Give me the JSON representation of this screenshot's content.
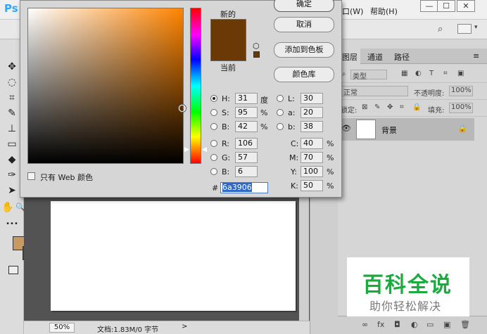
{
  "app": {
    "logo": "Ps",
    "menus": [
      "口(W)",
      "帮助(H)"
    ],
    "window_controls": [
      "—",
      "☐",
      "✕"
    ]
  },
  "tools": [
    "✥",
    "◌",
    "⌗",
    "✎",
    "⊥",
    "▭",
    "◆",
    "✑",
    "➤",
    "✋",
    "🔍",
    "•••"
  ],
  "status": {
    "zoom": "50%",
    "doc": "文档:1.83M/0 字节",
    "arrow": ">"
  },
  "layers_panel": {
    "tabs": [
      "图层",
      "通道",
      "路径"
    ],
    "filter_label": "类型",
    "blend_mode": "正常",
    "opacity_label": "不透明度:",
    "opacity_value": "100%",
    "lock_label": "锁定:",
    "fill_label": "填充:",
    "fill_value": "100%",
    "layer_name": "背景",
    "footer_icons": [
      "∞",
      "fx",
      "◘",
      "◐",
      "▭",
      "▣",
      "🗑"
    ]
  },
  "color_picker": {
    "new_label": "新的",
    "current_label": "当前",
    "new_color": "#6a3906",
    "current_color": "#6a3906",
    "buttons": {
      "ok": "确定",
      "cancel": "取消",
      "add_to_swatches": "添加到色板",
      "color_libraries": "颜色库"
    },
    "web_only_label": "只有 Web 颜色",
    "hsb": {
      "h_label": "H:",
      "h_value": "31",
      "h_unit": "度",
      "s_label": "S:",
      "s_value": "95",
      "s_unit": "%",
      "b_label": "B:",
      "b_value": "42",
      "b_unit": "%"
    },
    "rgb": {
      "r_label": "R:",
      "r_value": "106",
      "g_label": "G:",
      "g_value": "57",
      "b_label": "B:",
      "b_value": "6"
    },
    "lab": {
      "l_label": "L:",
      "l_value": "30",
      "a_label": "a:",
      "a_value": "20",
      "b_label": "b:",
      "b_value": "38"
    },
    "cmyk": {
      "c_label": "C:",
      "c_value": "40",
      "m_label": "M:",
      "m_value": "70",
      "y_label": "Y:",
      "y_value": "100",
      "k_label": "K:",
      "k_value": "50",
      "unit": "%"
    },
    "hex_label": "#",
    "hex_value": "6a3906",
    "selected_channel": "H"
  },
  "watermark": {
    "title": "百科全说",
    "subtitle": "助你轻松解决"
  }
}
